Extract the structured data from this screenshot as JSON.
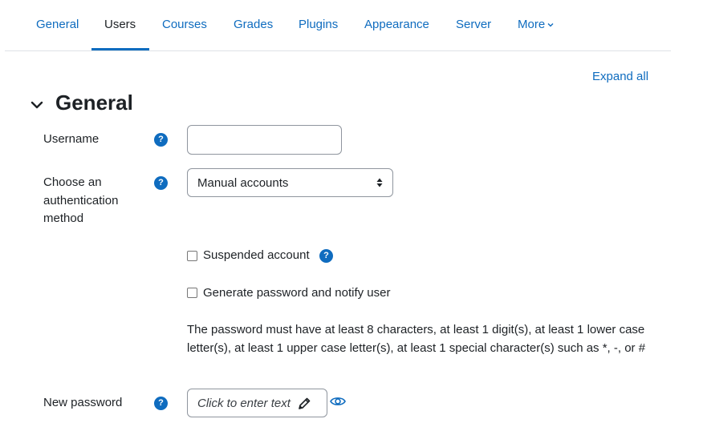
{
  "nav": {
    "tabs": [
      {
        "label": "General"
      },
      {
        "label": "Users"
      },
      {
        "label": "Courses"
      },
      {
        "label": "Grades"
      },
      {
        "label": "Plugins"
      },
      {
        "label": "Appearance"
      },
      {
        "label": "Server"
      },
      {
        "label": "More"
      }
    ],
    "active_tab": "Users"
  },
  "expand_all": "Expand all",
  "section": {
    "title": "General"
  },
  "fields": {
    "username": {
      "label": "Username",
      "value": ""
    },
    "auth": {
      "label": "Choose an authentication method",
      "selected": "Manual accounts"
    },
    "suspended": {
      "label": "Suspended account",
      "checked": false
    },
    "generate_password": {
      "label": "Generate password and notify user",
      "checked": false
    },
    "password_policy": "The password must have at least 8 characters, at least 1 digit(s), at least 1 lower case letter(s), at least 1 upper case letter(s), at least 1 special character(s) such as *, -, or #",
    "new_password": {
      "label": "New password",
      "placeholder": "Click to enter text"
    }
  },
  "help_icon_text": "?",
  "colors": {
    "accent": "#0f6cbf",
    "text": "#1d2125",
    "border": "#8f959e"
  }
}
